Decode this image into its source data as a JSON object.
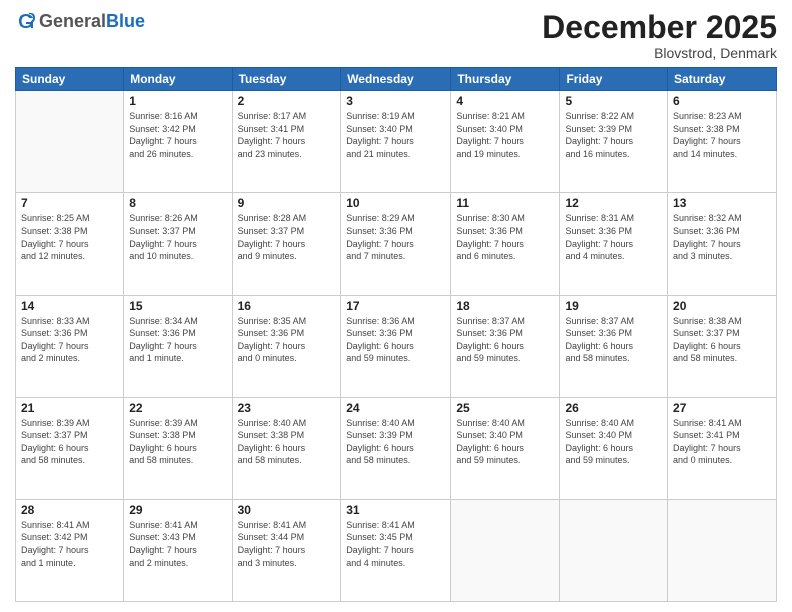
{
  "header": {
    "logo_general": "General",
    "logo_blue": "Blue",
    "month_title": "December 2025",
    "location": "Blovstrod, Denmark"
  },
  "days_of_week": [
    "Sunday",
    "Monday",
    "Tuesday",
    "Wednesday",
    "Thursday",
    "Friday",
    "Saturday"
  ],
  "weeks": [
    [
      {
        "day": "",
        "info": ""
      },
      {
        "day": "1",
        "info": "Sunrise: 8:16 AM\nSunset: 3:42 PM\nDaylight: 7 hours\nand 26 minutes."
      },
      {
        "day": "2",
        "info": "Sunrise: 8:17 AM\nSunset: 3:41 PM\nDaylight: 7 hours\nand 23 minutes."
      },
      {
        "day": "3",
        "info": "Sunrise: 8:19 AM\nSunset: 3:40 PM\nDaylight: 7 hours\nand 21 minutes."
      },
      {
        "day": "4",
        "info": "Sunrise: 8:21 AM\nSunset: 3:40 PM\nDaylight: 7 hours\nand 19 minutes."
      },
      {
        "day": "5",
        "info": "Sunrise: 8:22 AM\nSunset: 3:39 PM\nDaylight: 7 hours\nand 16 minutes."
      },
      {
        "day": "6",
        "info": "Sunrise: 8:23 AM\nSunset: 3:38 PM\nDaylight: 7 hours\nand 14 minutes."
      }
    ],
    [
      {
        "day": "7",
        "info": "Sunrise: 8:25 AM\nSunset: 3:38 PM\nDaylight: 7 hours\nand 12 minutes."
      },
      {
        "day": "8",
        "info": "Sunrise: 8:26 AM\nSunset: 3:37 PM\nDaylight: 7 hours\nand 10 minutes."
      },
      {
        "day": "9",
        "info": "Sunrise: 8:28 AM\nSunset: 3:37 PM\nDaylight: 7 hours\nand 9 minutes."
      },
      {
        "day": "10",
        "info": "Sunrise: 8:29 AM\nSunset: 3:36 PM\nDaylight: 7 hours\nand 7 minutes."
      },
      {
        "day": "11",
        "info": "Sunrise: 8:30 AM\nSunset: 3:36 PM\nDaylight: 7 hours\nand 6 minutes."
      },
      {
        "day": "12",
        "info": "Sunrise: 8:31 AM\nSunset: 3:36 PM\nDaylight: 7 hours\nand 4 minutes."
      },
      {
        "day": "13",
        "info": "Sunrise: 8:32 AM\nSunset: 3:36 PM\nDaylight: 7 hours\nand 3 minutes."
      }
    ],
    [
      {
        "day": "14",
        "info": "Sunrise: 8:33 AM\nSunset: 3:36 PM\nDaylight: 7 hours\nand 2 minutes."
      },
      {
        "day": "15",
        "info": "Sunrise: 8:34 AM\nSunset: 3:36 PM\nDaylight: 7 hours\nand 1 minute."
      },
      {
        "day": "16",
        "info": "Sunrise: 8:35 AM\nSunset: 3:36 PM\nDaylight: 7 hours\nand 0 minutes."
      },
      {
        "day": "17",
        "info": "Sunrise: 8:36 AM\nSunset: 3:36 PM\nDaylight: 6 hours\nand 59 minutes."
      },
      {
        "day": "18",
        "info": "Sunrise: 8:37 AM\nSunset: 3:36 PM\nDaylight: 6 hours\nand 59 minutes."
      },
      {
        "day": "19",
        "info": "Sunrise: 8:37 AM\nSunset: 3:36 PM\nDaylight: 6 hours\nand 58 minutes."
      },
      {
        "day": "20",
        "info": "Sunrise: 8:38 AM\nSunset: 3:37 PM\nDaylight: 6 hours\nand 58 minutes."
      }
    ],
    [
      {
        "day": "21",
        "info": "Sunrise: 8:39 AM\nSunset: 3:37 PM\nDaylight: 6 hours\nand 58 minutes."
      },
      {
        "day": "22",
        "info": "Sunrise: 8:39 AM\nSunset: 3:38 PM\nDaylight: 6 hours\nand 58 minutes."
      },
      {
        "day": "23",
        "info": "Sunrise: 8:40 AM\nSunset: 3:38 PM\nDaylight: 6 hours\nand 58 minutes."
      },
      {
        "day": "24",
        "info": "Sunrise: 8:40 AM\nSunset: 3:39 PM\nDaylight: 6 hours\nand 58 minutes."
      },
      {
        "day": "25",
        "info": "Sunrise: 8:40 AM\nSunset: 3:40 PM\nDaylight: 6 hours\nand 59 minutes."
      },
      {
        "day": "26",
        "info": "Sunrise: 8:40 AM\nSunset: 3:40 PM\nDaylight: 6 hours\nand 59 minutes."
      },
      {
        "day": "27",
        "info": "Sunrise: 8:41 AM\nSunset: 3:41 PM\nDaylight: 7 hours\nand 0 minutes."
      }
    ],
    [
      {
        "day": "28",
        "info": "Sunrise: 8:41 AM\nSunset: 3:42 PM\nDaylight: 7 hours\nand 1 minute."
      },
      {
        "day": "29",
        "info": "Sunrise: 8:41 AM\nSunset: 3:43 PM\nDaylight: 7 hours\nand 2 minutes."
      },
      {
        "day": "30",
        "info": "Sunrise: 8:41 AM\nSunset: 3:44 PM\nDaylight: 7 hours\nand 3 minutes."
      },
      {
        "day": "31",
        "info": "Sunrise: 8:41 AM\nSunset: 3:45 PM\nDaylight: 7 hours\nand 4 minutes."
      },
      {
        "day": "",
        "info": ""
      },
      {
        "day": "",
        "info": ""
      },
      {
        "day": "",
        "info": ""
      }
    ]
  ]
}
